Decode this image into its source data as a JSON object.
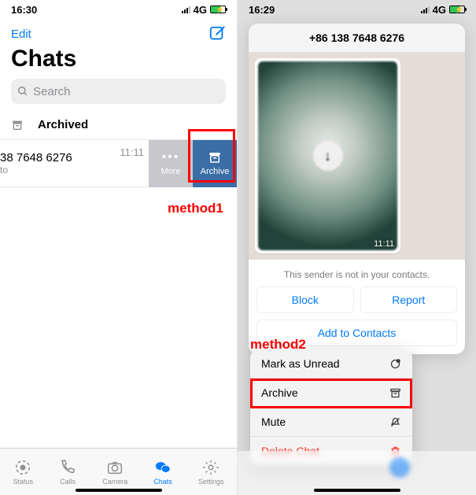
{
  "left": {
    "status": {
      "time": "16:30",
      "net": "4G"
    },
    "nav": {
      "edit": "Edit"
    },
    "title": "Chats",
    "search_placeholder": "Search",
    "archived_label": "Archived",
    "chat": {
      "name": "38 7648 6276",
      "sub": "to",
      "time": "11:11"
    },
    "swipe": {
      "more": "More",
      "archive": "Archive"
    },
    "annotation": "method1",
    "tabs": {
      "status": "Status",
      "calls": "Calls",
      "camera": "Camera",
      "chats": "Chats",
      "settings": "Settings"
    }
  },
  "right": {
    "status": {
      "time": "16:29",
      "net": "4G"
    },
    "preview": {
      "title": "+86 138 7648 6276",
      "bubble_time": "11:11",
      "notice": "This sender is not in your contacts.",
      "block": "Block",
      "report": "Report",
      "add": "Add to Contacts"
    },
    "annotation": "method2",
    "menu": {
      "unread": "Mark as Unread",
      "archive": "Archive",
      "mute": "Mute",
      "delete": "Delete Chat"
    }
  }
}
